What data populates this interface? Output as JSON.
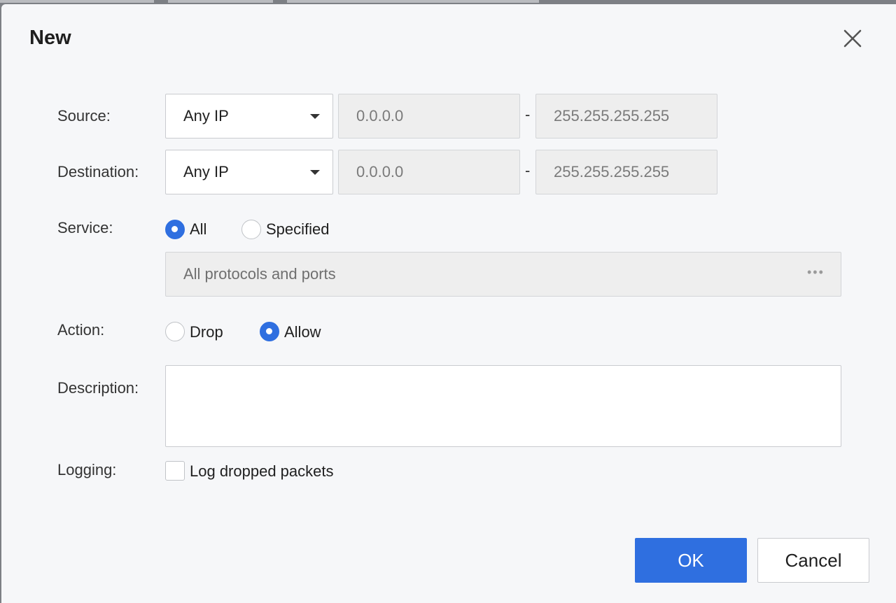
{
  "dialog": {
    "title": "New",
    "close_icon": "close-icon"
  },
  "source": {
    "label": "Source:",
    "type_value": "Any IP",
    "start_ip": "0.0.0.0",
    "separator": "-",
    "end_ip": "255.255.255.255"
  },
  "destination": {
    "label": "Destination:",
    "type_value": "Any IP",
    "start_ip": "0.0.0.0",
    "separator": "-",
    "end_ip": "255.255.255.255"
  },
  "service": {
    "label": "Service:",
    "options": [
      {
        "label": "All",
        "selected": true
      },
      {
        "label": "Specified",
        "selected": false
      }
    ],
    "value": "All protocols and ports",
    "more_icon": "ellipsis-icon",
    "more_glyph": "•••"
  },
  "action": {
    "label": "Action:",
    "options": [
      {
        "label": "Drop",
        "selected": false
      },
      {
        "label": "Allow",
        "selected": true
      }
    ]
  },
  "description": {
    "label": "Description:",
    "value": ""
  },
  "logging": {
    "label": "Logging:",
    "checkbox_label": "Log dropped packets",
    "checked": false
  },
  "buttons": {
    "ok": "OK",
    "cancel": "Cancel"
  },
  "colors": {
    "accent": "#2f6fe0",
    "dialog_bg": "#f6f7f9",
    "disabled_field": "#eeeeee"
  }
}
